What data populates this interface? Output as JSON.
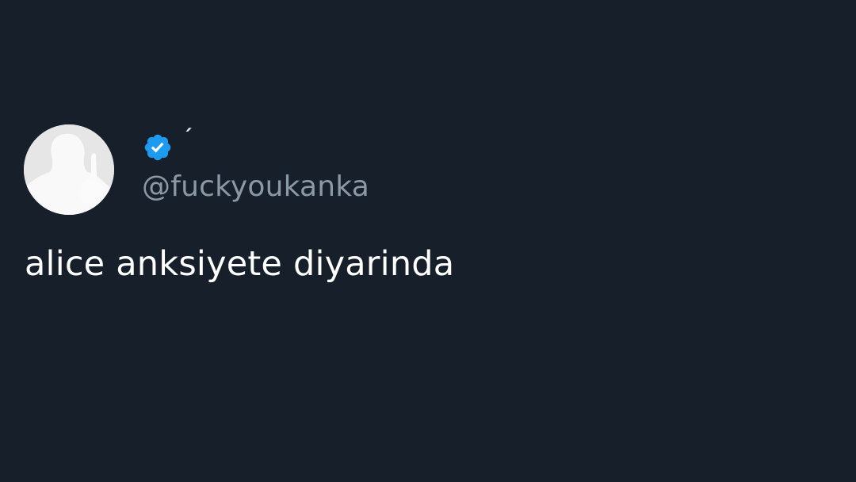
{
  "tweet": {
    "display_name": "´",
    "handle": "@fuckyoukanka",
    "text": "alice anksiyete diyarinda",
    "verified": true,
    "avatar_icon": "user-silhouette-icon",
    "verified_icon": "verified-badge-icon"
  },
  "colors": {
    "background": "#17202a",
    "text": "#ffffff",
    "handle": "#8b98a5",
    "verified": "#1d9bf0",
    "avatar_background": "#e7e7e7"
  }
}
